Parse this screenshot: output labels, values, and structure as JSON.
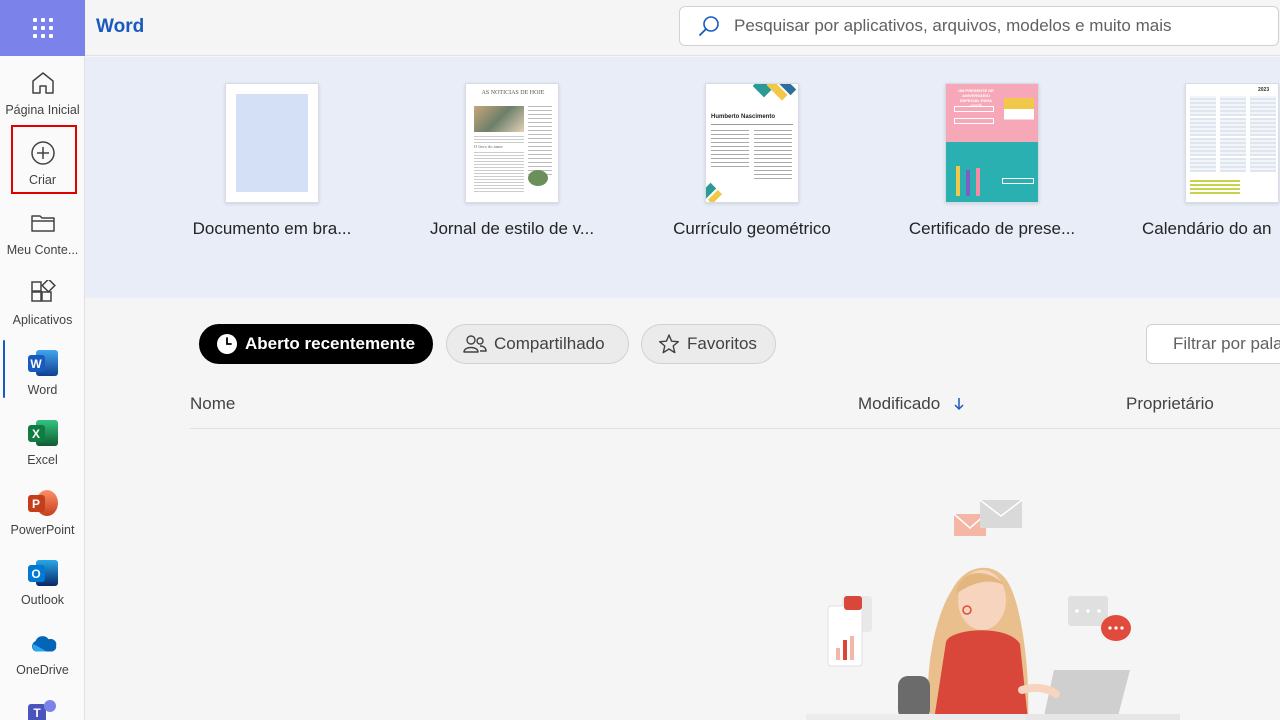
{
  "app": {
    "title": "Word"
  },
  "search": {
    "placeholder": "Pesquisar por aplicativos, arquivos, modelos e muito mais"
  },
  "rail": {
    "items": [
      {
        "label": "Página Inicial",
        "icon": "home-icon"
      },
      {
        "label": "Criar",
        "icon": "plus-circle-icon"
      },
      {
        "label": "Meu Conte...",
        "icon": "folder-icon"
      },
      {
        "label": "Aplicativos",
        "icon": "apps-icon"
      },
      {
        "label": "Word",
        "icon": "word-icon",
        "letter": "W"
      },
      {
        "label": "Excel",
        "icon": "excel-icon",
        "letter": "X"
      },
      {
        "label": "PowerPoint",
        "icon": "powerpoint-icon",
        "letter": "P"
      },
      {
        "label": "Outlook",
        "icon": "outlook-icon",
        "letter": "O"
      },
      {
        "label": "OneDrive",
        "icon": "onedrive-icon"
      }
    ]
  },
  "templates": [
    {
      "name": "Documento em bra..."
    },
    {
      "name": "Jornal de estilo de v...",
      "thumb_heading": "AS NOTÍCIAS DE HOJE",
      "thumb_sub": "O livro do amor"
    },
    {
      "name": "Currículo geométrico",
      "thumb_heading": "Humberto Nascimento"
    },
    {
      "name": "Certificado de prese...",
      "thumb_heading": "UM PRESENTE DE ANIVERSÁRIO ESPECIAL PARA VOCÊ"
    },
    {
      "name": "Calendário do an",
      "thumb_heading": "2023"
    }
  ],
  "tabs": [
    {
      "label": "Aberto recentemente",
      "icon": "clock-icon"
    },
    {
      "label": "Compartilhado",
      "icon": "people-icon"
    },
    {
      "label": "Favoritos",
      "icon": "star-icon"
    }
  ],
  "filter": {
    "placeholder": "Filtrar por palavra-chave"
  },
  "table": {
    "columns": {
      "name": "Nome",
      "modified": "Modificado",
      "owner": "Proprietário"
    },
    "sort_icon": "arrow-down-icon"
  },
  "colors": {
    "brand": "#185abd",
    "waffle": "#7b83eb",
    "highlight": "#e00000"
  }
}
